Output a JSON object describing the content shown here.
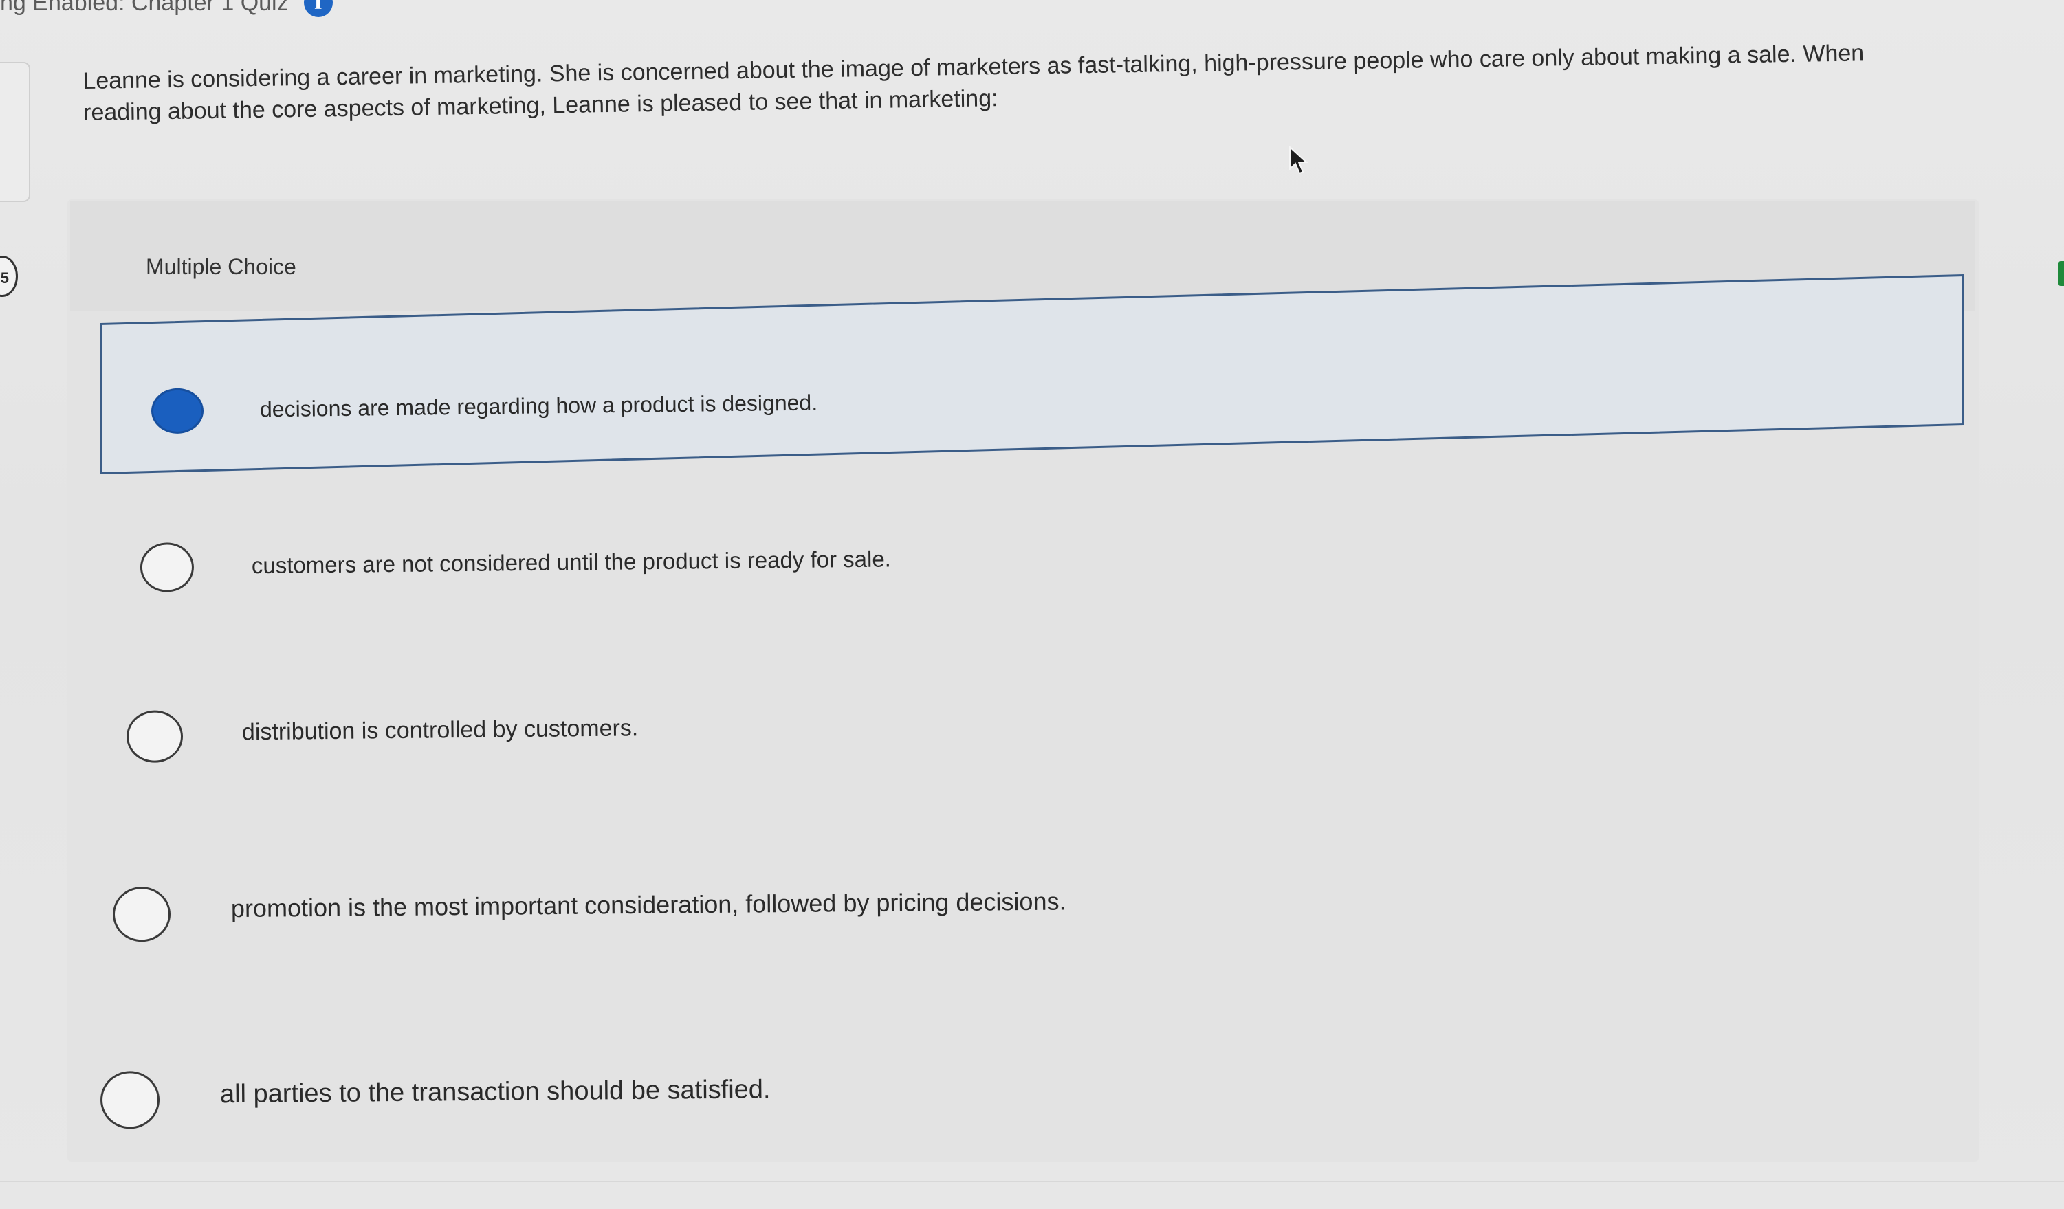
{
  "header": {
    "title": "ng Enabled: Chapter 1 Quiz",
    "info_icon_glyph": "i"
  },
  "sidebar": {
    "badge": "5"
  },
  "question": {
    "text": "Leanne is considering a career in marketing. She is concerned about the image of marketers as fast-talking, high-pressure people who care only about making a sale. When reading about the core aspects of marketing, Leanne is pleased to see that in marketing:",
    "type_label": "Multiple Choice"
  },
  "options": [
    {
      "label": "decisions are made regarding how a product is designed.",
      "selected": true
    },
    {
      "label": "customers are not considered until the product is ready for sale.",
      "selected": false
    },
    {
      "label": "distribution is controlled by customers.",
      "selected": false
    },
    {
      "label": "promotion is the most important consideration, followed by pricing decisions.",
      "selected": false
    },
    {
      "label": "all parties to the transaction should be satisfied.",
      "selected": false
    }
  ],
  "colors": {
    "accent": "#1a5fbf",
    "selected_border": "#3b5d88",
    "selected_bg": "#dfe4ea"
  }
}
